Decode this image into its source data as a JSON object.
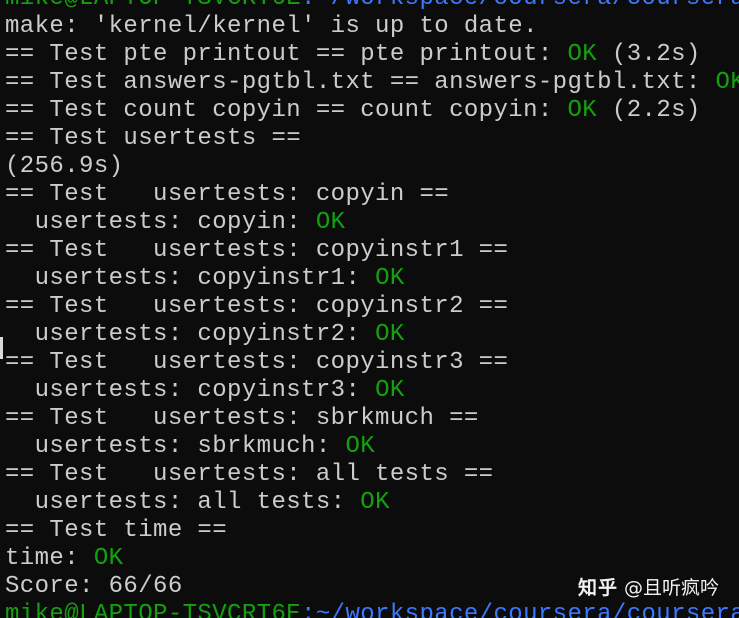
{
  "terminal": {
    "colors": {
      "background": "#0c0c0c",
      "text": "#cccccc",
      "ok": "#13a10e",
      "prompt_user": "#13a10e",
      "prompt_path": "#3b78ff"
    },
    "top_prompt": {
      "user_host": "mike@LAPTOP-TSVCRT6E",
      "path": ":~/workspace/coursera/coursera/MI"
    },
    "lines": [
      {
        "pre": "make: 'kernel/kernel' is up to date.",
        "ok": "",
        "post": ""
      },
      {
        "pre": "== Test pte printout == pte printout: ",
        "ok": "OK",
        "post": " (3.2s)"
      },
      {
        "pre": "== Test answers-pgtbl.txt == answers-pgtbl.txt: ",
        "ok": "OK",
        "post": ""
      },
      {
        "pre": "== Test count copyin == count copyin: ",
        "ok": "OK",
        "post": " (2.2s)"
      },
      {
        "pre": "== Test usertests ==",
        "ok": "",
        "post": ""
      },
      {
        "pre": "(256.9s)",
        "ok": "",
        "post": ""
      },
      {
        "pre": "== Test   usertests: copyin ==",
        "ok": "",
        "post": ""
      },
      {
        "pre": "  usertests: copyin: ",
        "ok": "OK",
        "post": ""
      },
      {
        "pre": "== Test   usertests: copyinstr1 ==",
        "ok": "",
        "post": ""
      },
      {
        "pre": "  usertests: copyinstr1: ",
        "ok": "OK",
        "post": ""
      },
      {
        "pre": "== Test   usertests: copyinstr2 ==",
        "ok": "",
        "post": ""
      },
      {
        "pre": "  usertests: copyinstr2: ",
        "ok": "OK",
        "post": ""
      },
      {
        "pre": "== Test   usertests: copyinstr3 ==",
        "ok": "",
        "post": ""
      },
      {
        "pre": "  usertests: copyinstr3: ",
        "ok": "OK",
        "post": ""
      },
      {
        "pre": "== Test   usertests: sbrkmuch ==",
        "ok": "",
        "post": ""
      },
      {
        "pre": "  usertests: sbrkmuch: ",
        "ok": "OK",
        "post": ""
      },
      {
        "pre": "== Test   usertests: all tests ==",
        "ok": "",
        "post": ""
      },
      {
        "pre": "  usertests: all tests: ",
        "ok": "OK",
        "post": ""
      },
      {
        "pre": "== Test time ==",
        "ok": "",
        "post": ""
      },
      {
        "pre": "time: ",
        "ok": "OK",
        "post": ""
      },
      {
        "pre": "Score: 66/66",
        "ok": "",
        "post": ""
      }
    ],
    "bottom_prompt": {
      "user_host": "mike@LAPTOP-TSVCRT6E",
      "path": ":~/workspace/coursera/coursera/MI"
    }
  },
  "watermark": {
    "brand": "知乎",
    "author": "@且听疯吟"
  }
}
